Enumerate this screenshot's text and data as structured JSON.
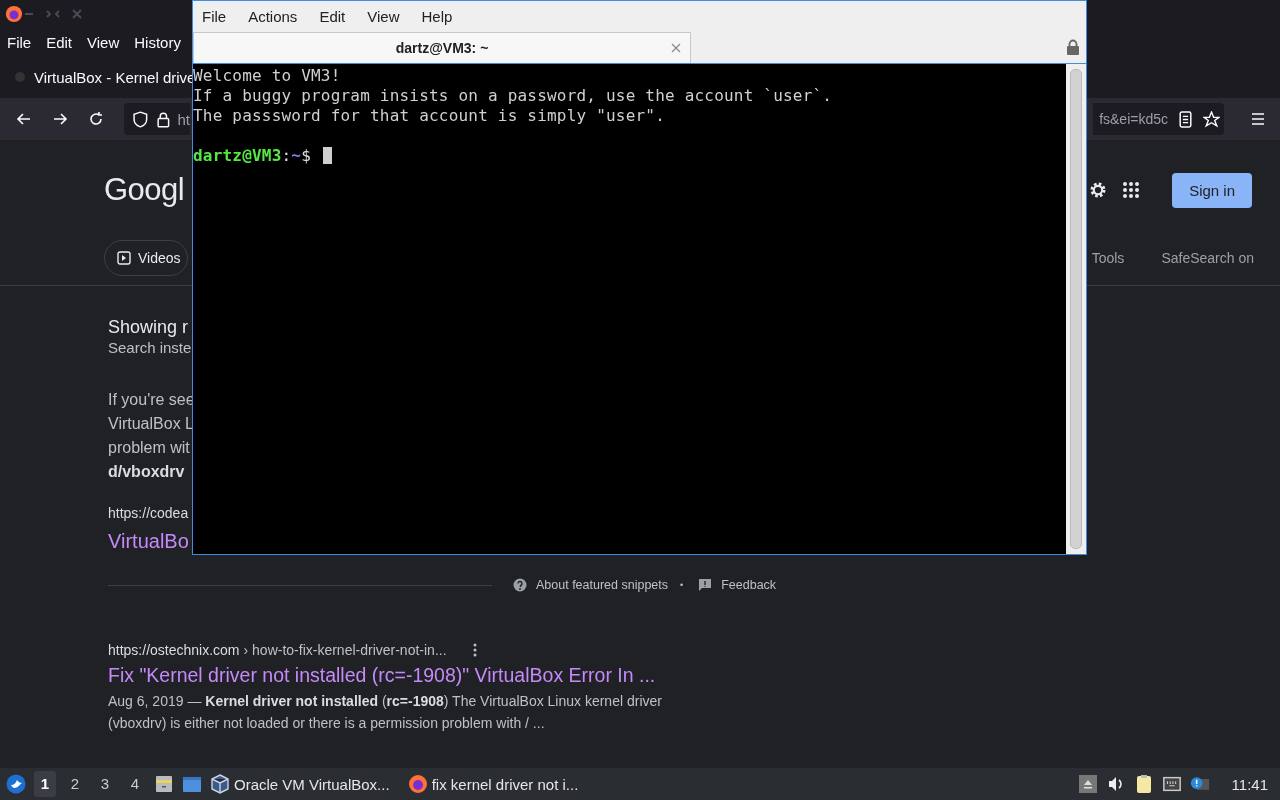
{
  "browser": {
    "menu": [
      "File",
      "Edit",
      "View",
      "History"
    ],
    "tab": {
      "title": "VirtualBox - Kernel drive"
    },
    "address": {
      "start": "ht",
      "end": "fs&ei=kd5c"
    },
    "google": {
      "logo": "Googl",
      "chips": [
        {
          "label": "Videos"
        }
      ],
      "sign_in": "Sign in",
      "tools": "Tools",
      "safesearch": "SafeSearch on",
      "featured": {
        "heading": "Showing r",
        "subheading": "Search inste",
        "lines": [
          "If you're see",
          "VirtualBox L",
          "problem wit"
        ],
        "bold_line": "d/vboxdrv",
        "url": "https://codea",
        "title": "VirtualBo"
      },
      "footer": {
        "about": "About featured snippets",
        "dot": "•",
        "feedback": "Feedback"
      },
      "results": [
        {
          "url": "https://ostechnix.com",
          "path": "› how-to-fix-kernel-driver-not-in...",
          "title": "Fix \"Kernel driver not installed (rc=-1908)\" VirtualBox Error In ...",
          "snippet": "Aug 6, 2019 — **Kernel driver not installed** (**rc=-1908**) The VirtualBox Linux kernel driver (vboxdrv) is either not loaded or there is a permission problem with / ..."
        }
      ]
    }
  },
  "terminal": {
    "menu": [
      "File",
      "Actions",
      "Edit",
      "View",
      "Help"
    ],
    "tab": {
      "title": "dartz@VM3: ~"
    },
    "lines": [
      "Welcome to VM3!",
      "If a buggy program insists on a password, use the account `user`.",
      "The passsword for that account is simply \"user\"."
    ],
    "prompt": {
      "user_host": "dartz@VM3",
      "sep": ":",
      "path": "~",
      "symbol": "$"
    }
  },
  "taskbar": {
    "workspaces": [
      {
        "label": "1",
        "selected": true
      },
      {
        "label": "2",
        "selected": false
      },
      {
        "label": "3",
        "selected": false
      },
      {
        "label": "4",
        "selected": false
      }
    ],
    "tasks": [
      {
        "kind": "virtualbox",
        "label": "Oracle VM VirtualBox..."
      },
      {
        "kind": "firefox",
        "label": "fix kernel driver not i..."
      }
    ],
    "clock": "11:41"
  }
}
